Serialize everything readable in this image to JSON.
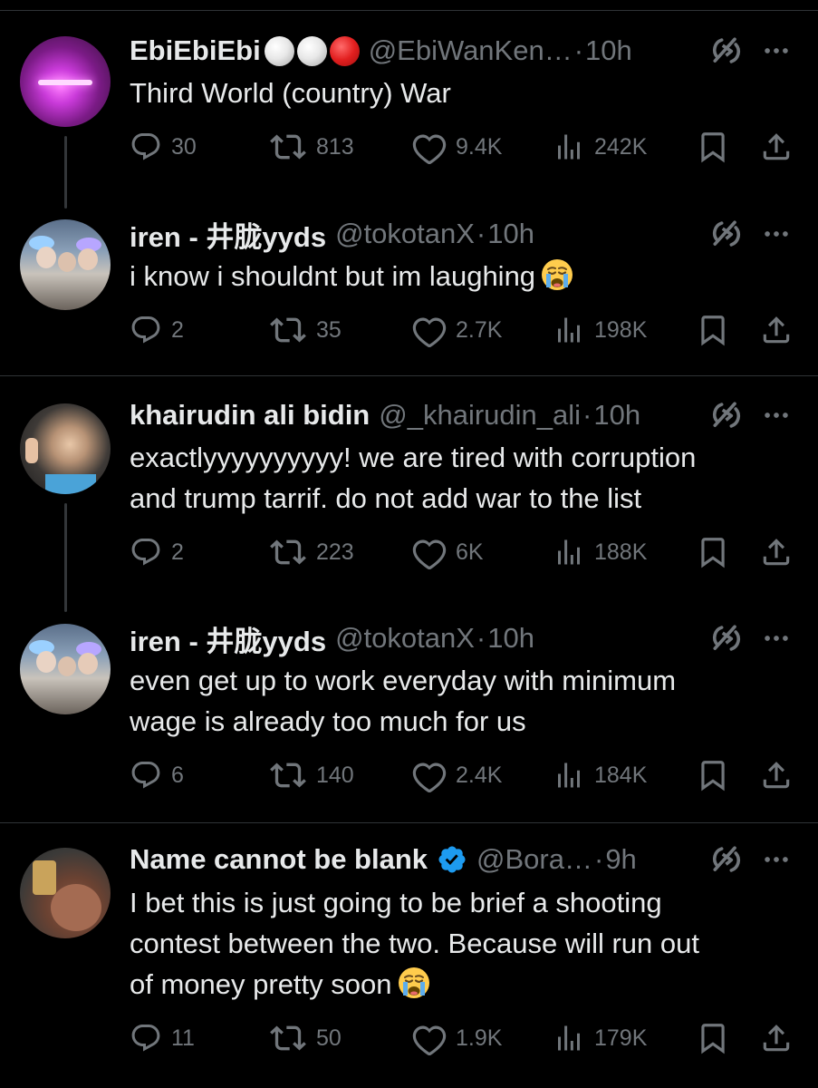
{
  "theme": {
    "background": "#000000",
    "text": "#e7e9ea",
    "muted": "#71767b",
    "verified": "#1d9bf0",
    "divider": "#2f3336"
  },
  "tweets": [
    {
      "name": "EbiEbiEbi",
      "name_badges": [
        "white-circle",
        "white-circle",
        "red-circle"
      ],
      "handle": "@EbiWanKen…",
      "dot": "·",
      "time": "10h",
      "lines": [
        "Third World (country) War"
      ],
      "replies": "30",
      "retweets": "813",
      "likes": "9.4K",
      "views": "242K"
    },
    {
      "name": "iren - 井胧yyds",
      "handle": "@tokotanX",
      "dot": "·",
      "time": "10h",
      "lines": [
        "i know i shouldnt but im laughing"
      ],
      "emoji": "crying-face",
      "replies": "2",
      "retweets": "35",
      "likes": "2.7K",
      "views": "198K"
    },
    {
      "name": "khairudin ali bidin",
      "handle": "@_khairudin_ali",
      "dot": "·",
      "time": "10h",
      "lines": [
        "exactlyyyyyyyyyy! we are tired with corruption",
        "and trump tarrif. do not add war to the list"
      ],
      "replies": "2",
      "retweets": "223",
      "likes": "6K",
      "views": "188K"
    },
    {
      "name": "iren - 井胧yyds",
      "handle": "@tokotanX",
      "dot": "·",
      "time": "10h",
      "lines": [
        "even get up to work everyday with minimum",
        "wage is already too much for us"
      ],
      "replies": "6",
      "retweets": "140",
      "likes": "2.4K",
      "views": "184K"
    },
    {
      "name": "Name cannot be blank",
      "verified": true,
      "handle": "@Bora…",
      "dot": "·",
      "time": "9h",
      "lines": [
        "I bet this is just going to be brief a shooting",
        "contest between the two. Because will run out",
        "of money pretty soon"
      ],
      "emoji": "crying-face",
      "replies": "11",
      "retweets": "50",
      "likes": "1.9K",
      "views": "179K"
    }
  ]
}
